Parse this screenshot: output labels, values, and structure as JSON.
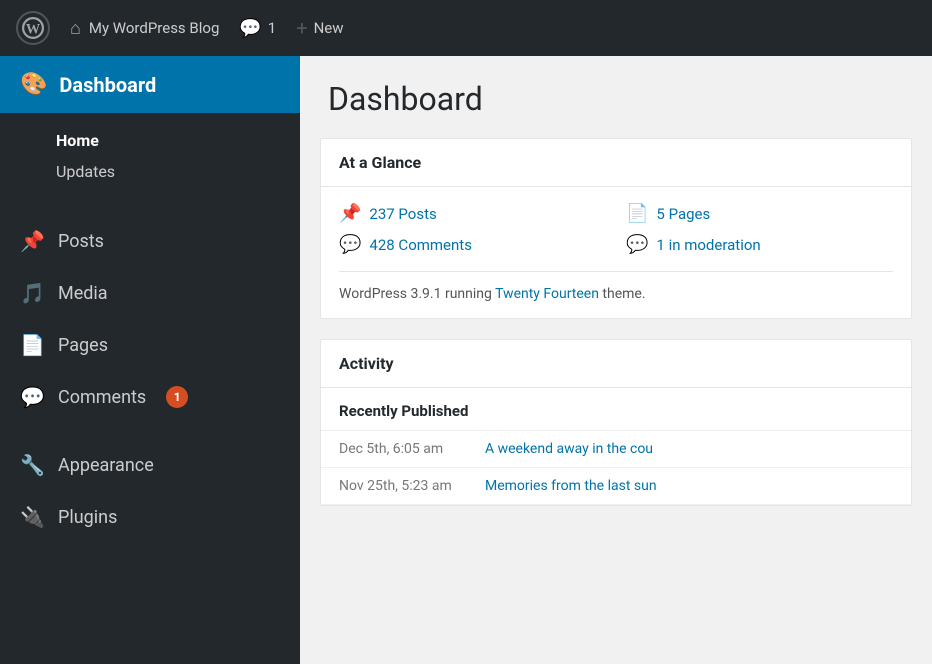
{
  "adminbar": {
    "site_name": "My WordPress Blog",
    "comments_count": "1",
    "new_label": "New"
  },
  "sidebar": {
    "dashboard_label": "Dashboard",
    "home_label": "Home",
    "updates_label": "Updates",
    "posts_label": "Posts",
    "media_label": "Media",
    "pages_label": "Pages",
    "comments_label": "Comments",
    "comments_badge": "1",
    "appearance_label": "Appearance",
    "plugins_label": "Plugins"
  },
  "main": {
    "title": "Dashboard",
    "at_a_glance": {
      "header": "At a Glance",
      "posts_count": "237 Posts",
      "pages_count": "5 Pages",
      "comments_count": "428 Comments",
      "moderation_count": "1 in moderation",
      "wp_version": "WordPress 3.9.1 running ",
      "theme_name": "Twenty Fourteen",
      "theme_suffix": " theme."
    },
    "activity": {
      "header": "Activity",
      "recently_published": "Recently Published",
      "items": [
        {
          "date": "Dec 5th, 6:05 am",
          "title": "A weekend away in the cou"
        },
        {
          "date": "Nov 25th, 5:23 am",
          "title": "Memories from the last sun"
        }
      ]
    }
  }
}
